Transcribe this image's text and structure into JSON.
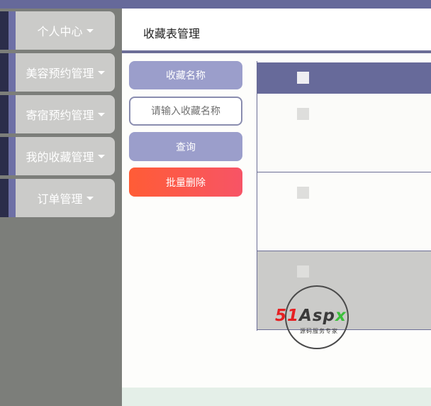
{
  "sidebar": {
    "items": [
      {
        "label": "个人中心"
      },
      {
        "label": "美容预约管理"
      },
      {
        "label": "寄宿预约管理"
      },
      {
        "label": "我的收藏管理"
      },
      {
        "label": "订单管理"
      }
    ]
  },
  "header": {
    "title": "收藏表管理"
  },
  "search": {
    "field_label": "收藏名称",
    "placeholder": "请输入收藏名称",
    "query_label": "查询",
    "batch_delete_label": "批量删除"
  },
  "table": {
    "rows": [
      {},
      {},
      {}
    ]
  },
  "watermark": {
    "brand_red": "51",
    "brand_dark": "Asp",
    "brand_green": "x",
    "tagline": "源码服务专家"
  },
  "colors": {
    "accent": "#676a9a",
    "button": "#9b9ecb",
    "danger_start": "#ff5c36",
    "danger_end": "#f75466"
  }
}
